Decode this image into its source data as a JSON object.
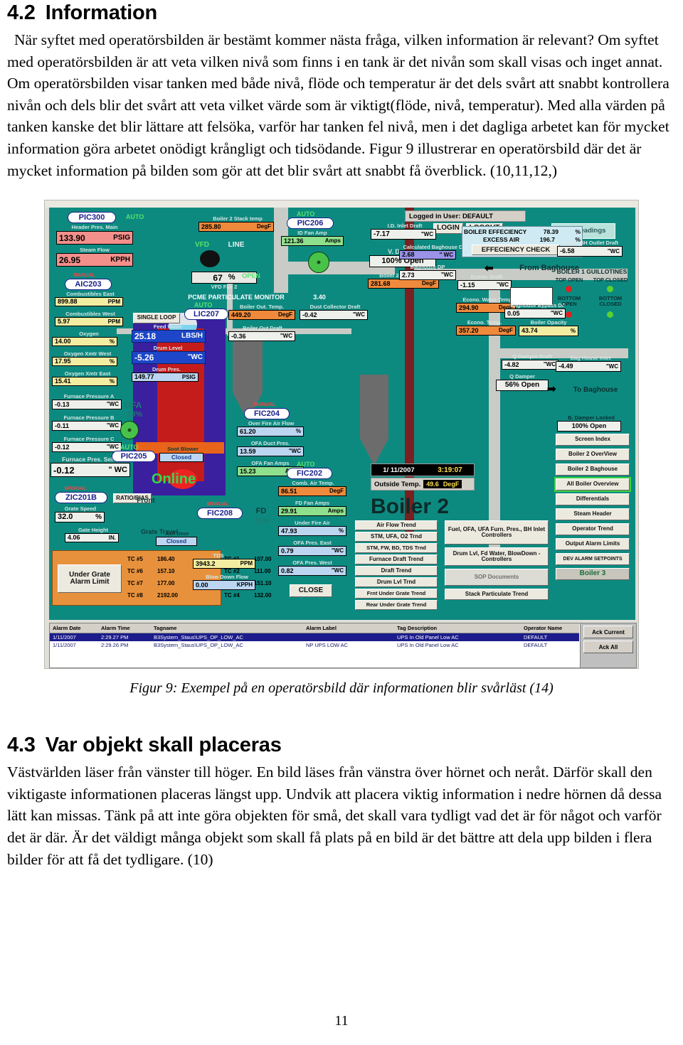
{
  "section_42": {
    "number": "4.2",
    "title": "Information",
    "paragraphs": [
      "När syftet med operatörsbilden är bestämt kommer nästa fråga, vilken information är relevant? Om syftet med operatörsbilden är att veta vilken nivå som finns i en tank är det nivån som skall visas och inget annat. Om operatörsbilden visar tanken med både nivå, flöde och temperatur är det dels svårt att snabbt kontrollera nivån och dels blir det svårt att veta vilket värde som är viktigt(flöde, nivå, temperatur). Med alla värden på tanken kanske det blir lättare att felsöka, varför har tanken fel nivå, men i det dagliga arbetet kan för mycket information göra arbetet onödigt krångligt och tidsödande. Figur 9 illustrerar en operatörsbild där det är mycket information på bilden som gör att det blir svårt att snabbt få överblick. (10,11,12,)"
    ]
  },
  "figure": {
    "caption": "Figur 9: Exempel på en operatörsbild där informationen blir svårläst (14)"
  },
  "section_43": {
    "number": "4.3",
    "title": "Var objekt skall placeras",
    "paragraphs": [
      "Västvärlden läser från vänster till höger. En bild läses från vänstra över hörnet och neråt. Därför skall den viktigaste informationen placeras längst upp. Undvik att placera viktig information i nedre hörnen då dessa lätt kan missas. Tänk på att inte göra objekten för små, det skall vara tydligt vad det är för något och varför det är där. Är det väldigt många objekt som skall få plats på en bild är det bättre att dela upp bilden i flera bilder för att få det tydligare. (10)"
    ]
  },
  "page_number": "11",
  "scada": {
    "header": {
      "logged_in_user": "Logged in User: DEFAULT",
      "login": "LOGIN",
      "logout": "LOGOUT",
      "log_readings": "Log Readings"
    },
    "title": "Boiler 2",
    "online_text": "Online",
    "datetime": "1/ 11/2007",
    "clock": "3:19:07",
    "outside_temp_label": "Outside Temp.",
    "outside_temp_value": "49.6",
    "outside_temp_unit": "DegF",
    "single_loop": "SINGLE LOOP",
    "ratio_bias": "RATIO/BIAS",
    "close_button": "CLOSE",
    "from_baghouse": "From Baghouse",
    "to_baghouse": "To Baghouse",
    "pcme_label": "PCME PARTICULATE MONITOR",
    "pcme_value": "3.40",
    "open_label": "OPEN",
    "vfd_label": "VFD",
    "line_label": "LINE",
    "vfd_fan_label": "VFD Fan 2",
    "vfd_value": "67",
    "vfd_unit": "%",
    "v_damper_label": "V. Damper",
    "v_damper_value": "100% Open",
    "q_damper_label": "Q Damper",
    "q_damper_value": "56% Open",
    "soot_blower_label": "Soot Blower",
    "soot_blower_value": "Closed",
    "ash_door_label": "Ash Door",
    "ash_door_value": "Closed",
    "ofa_label": "OFA",
    "ofa_pct": "13%",
    "fd_label": "FD",
    "fd_pct": "31%",
    "front_label": "Front",
    "grate_travel_label": "Grate Travel",
    "under_grate_alarm": "Under Grate Alarm Limit",
    "damper_locked_label": "B. Damper Locked",
    "damper_locked_value": "100% Open",
    "tags": [
      {
        "name": "PIC300",
        "mode": "AUTO"
      },
      {
        "name": "AIC203",
        "mode": "MANUAL"
      },
      {
        "name": "ZIC201B",
        "mode": "MANUAL"
      },
      {
        "name": "PIC205",
        "mode": "AUTO"
      },
      {
        "name": "LIC207",
        "mode": "AUTO"
      },
      {
        "name": "PIC206",
        "mode": "AUTO"
      },
      {
        "name": "FIC204",
        "mode": "MANUAL"
      },
      {
        "name": "FIC202",
        "mode": "AUTO"
      },
      {
        "name": "FIC208",
        "mode": "MANUAL"
      }
    ],
    "readouts": [
      {
        "label": "Header Pres. Main",
        "value": "133.90",
        "unit": "PSIG"
      },
      {
        "label": "Steam Flow",
        "value": "26.95",
        "unit": "KPPH"
      },
      {
        "label": "Combustibles East",
        "value": "899.88",
        "unit": "PPM"
      },
      {
        "label": "Combustibles West",
        "value": "5.97",
        "unit": "PPM"
      },
      {
        "label": "Oxygen",
        "value": "14.00",
        "unit": "%"
      },
      {
        "label": "Oxygen Xmtr West",
        "value": "17.95",
        "unit": "%"
      },
      {
        "label": "Oxygen Xmtr East",
        "value": "15.41",
        "unit": "%"
      },
      {
        "label": "Furnace Pressure A",
        "value": "-0.13",
        "unit": "\"WC"
      },
      {
        "label": "Furnace Pressure B",
        "value": "-0.11",
        "unit": "\"WC"
      },
      {
        "label": "Furnace Pressure C",
        "value": "-0.12",
        "unit": "\"WC"
      },
      {
        "label": "Furnace Pres. Select",
        "value": "-0.12",
        "unit": "\" WC"
      },
      {
        "label": "Grate Speed",
        "value": "32.0",
        "unit": "%"
      },
      {
        "label": "Gate Height",
        "value": "4.06",
        "unit": "IN."
      },
      {
        "label": "Feed Water",
        "value": "25.18",
        "unit": "LBS/H"
      },
      {
        "label": "Drum Level",
        "value": "-5.26",
        "unit": "\"WC"
      },
      {
        "label": "Drum Pres.",
        "value": "149.77",
        "unit": "PSIG"
      },
      {
        "label": "Boiler 2 Stack temp",
        "value": "285.80",
        "unit": "DegF"
      },
      {
        "label": "ID Fan Amp",
        "value": "121.36",
        "unit": "Amps"
      },
      {
        "label": "I.D. Inlet Draft",
        "value": "-7.17",
        "unit": "\"WC"
      },
      {
        "label": "Boiler 2 ID Inlet Tem",
        "value": "281.68",
        "unit": "DegF"
      },
      {
        "label": "Boiler Out. Temp.",
        "value": "449.20",
        "unit": "DegF"
      },
      {
        "label": "Dust Collector Draft",
        "value": "-0.42",
        "unit": "\"WC"
      },
      {
        "label": "Boiler Out Draft",
        "value": "-0.36",
        "unit": "\"WC"
      },
      {
        "label": "Over Fire Air Flow",
        "value": "61.20",
        "unit": "%"
      },
      {
        "label": "OFA Duct Pres.",
        "value": "13.59",
        "unit": "\"WC"
      },
      {
        "label": "OFA Fan Amps",
        "value": "15.23",
        "unit": "Amps"
      },
      {
        "label": "Comb. Air Temp.",
        "value": "86.51",
        "unit": "DegF"
      },
      {
        "label": "FD Fan Amps",
        "value": "29.91",
        "unit": "Amps"
      },
      {
        "label": "Under Fire Air",
        "value": "47.93",
        "unit": "%"
      },
      {
        "label": "OFA Pres. East",
        "value": "0.79",
        "unit": "\"WC"
      },
      {
        "label": "OFA Pres. West",
        "value": "0.82",
        "unit": "\"WC"
      },
      {
        "label": "TDS",
        "value": "3943.2",
        "unit": "PPM"
      },
      {
        "label": "Blow Down Flow",
        "value": "0.00",
        "unit": "KPPH"
      },
      {
        "label": "Calculated Baghouse DP",
        "value": "2.68",
        "unit": "\" WC"
      },
      {
        "label": "Baghouse DP",
        "value": "2.73",
        "unit": "\"WC"
      },
      {
        "label": "East BH Outlet Draft",
        "value": "-6.58",
        "unit": "\"WC"
      },
      {
        "label": "Baghouse Bypass DP",
        "value": "0.05",
        "unit": "\"WC"
      },
      {
        "label": "Bag House Inlet",
        "value": "-4.49",
        "unit": "\"WC"
      },
      {
        "label": "Econo. Draft",
        "value": "-1.15",
        "unit": "\"WC"
      },
      {
        "label": "Econo. Water Temp.",
        "value": "294.90",
        "unit": "DegF"
      },
      {
        "label": "Econo. Temp.",
        "value": "357.20",
        "unit": "DegF"
      },
      {
        "label": "Boiler Opacity",
        "value": "43.74",
        "unit": "%"
      },
      {
        "label": "Q Damper Draft",
        "value": "-4.82",
        "unit": "\"WC"
      }
    ],
    "efficiency": {
      "eff_label": "BOILER EFFECIENCY",
      "eff_value": "78.39",
      "eff_unit": "%",
      "air_label": "EXCESS AIR",
      "air_value": "196.7",
      "air_unit": "%",
      "check_button": "EFFECIENCY CHECK"
    },
    "guillotines": {
      "title": "BOILER 1 GUILLOTINES",
      "top_open": "TOP OPEN",
      "top_closed": "TOP CLOSED",
      "bottom_open": "BOTTOM OPEN",
      "bottom_closed": "BOTTOM CLOSED",
      "open_color": "#e02020",
      "closed_color": "#5ad12e"
    },
    "tc_left": [
      {
        "tag": "TC #5",
        "value": "186.40"
      },
      {
        "tag": "TC #6",
        "value": "157.10"
      },
      {
        "tag": "TC #7",
        "value": "177.00"
      },
      {
        "tag": "TC #8",
        "value": "2192.00"
      }
    ],
    "tc_right": [
      {
        "tag": "TC #1",
        "value": "107.00"
      },
      {
        "tag": "TC #2",
        "value": "111.00"
      },
      {
        "tag": "TC #3",
        "value": "151.10"
      },
      {
        "tag": "TC #4",
        "value": "132.00"
      }
    ],
    "trend_buttons": [
      "Air Flow Trend",
      "STM, UFA, O2 Trnd",
      "STM, FW, BD, TDS Trnd",
      "Furnace Draft Trend",
      "Draft Trend",
      "Drum Lvl Trnd",
      "Frnt Under Grate Trend",
      "Rear Under Grate Trend"
    ],
    "controller_buttons": [
      "Fuel, OFA, UFA Furn. Pres., BH Inlet Controllers",
      "Drum Lvl, Fd Water, BlowDown - Controllers",
      "SOP Documents",
      "Stack Particulate Trend"
    ],
    "nav_buttons": [
      "Screen Index",
      "Boiler 2 OverView",
      "Boiler 2 Baghouse",
      "All Boiler Overview",
      "Differentials",
      "Steam Header",
      "Operator Trend",
      "Output Alarm Limits",
      "DEV ALARM SETPOINTS",
      "Boiler 3"
    ],
    "nav_selected": "All Boiler Overview",
    "alarm_table": {
      "columns": [
        "Alarm Date",
        "Alarm Time",
        "Tagname",
        "Alarm Label",
        "Tag Description",
        "Operator Name"
      ],
      "rows": [
        {
          "date": "1/11/2007",
          "time": "2:29.27 PM",
          "tagname": "B3System_Staus\\UPS_OP_LOW_AC",
          "label": "",
          "description": "UPS In Old Panel Low AC",
          "operator": "DEFAULT"
        },
        {
          "date": "1/11/2007",
          "time": "2:29.26 PM",
          "tagname": "B3System_Staus\\UPS_OP_LOW_AC",
          "label": "NP UPS LOW AC",
          "description": "UPS In Old Panel Low AC",
          "operator": "DEFAULT"
        }
      ],
      "ack_current": "Ack Current",
      "ack_all": "Ack All"
    }
  }
}
